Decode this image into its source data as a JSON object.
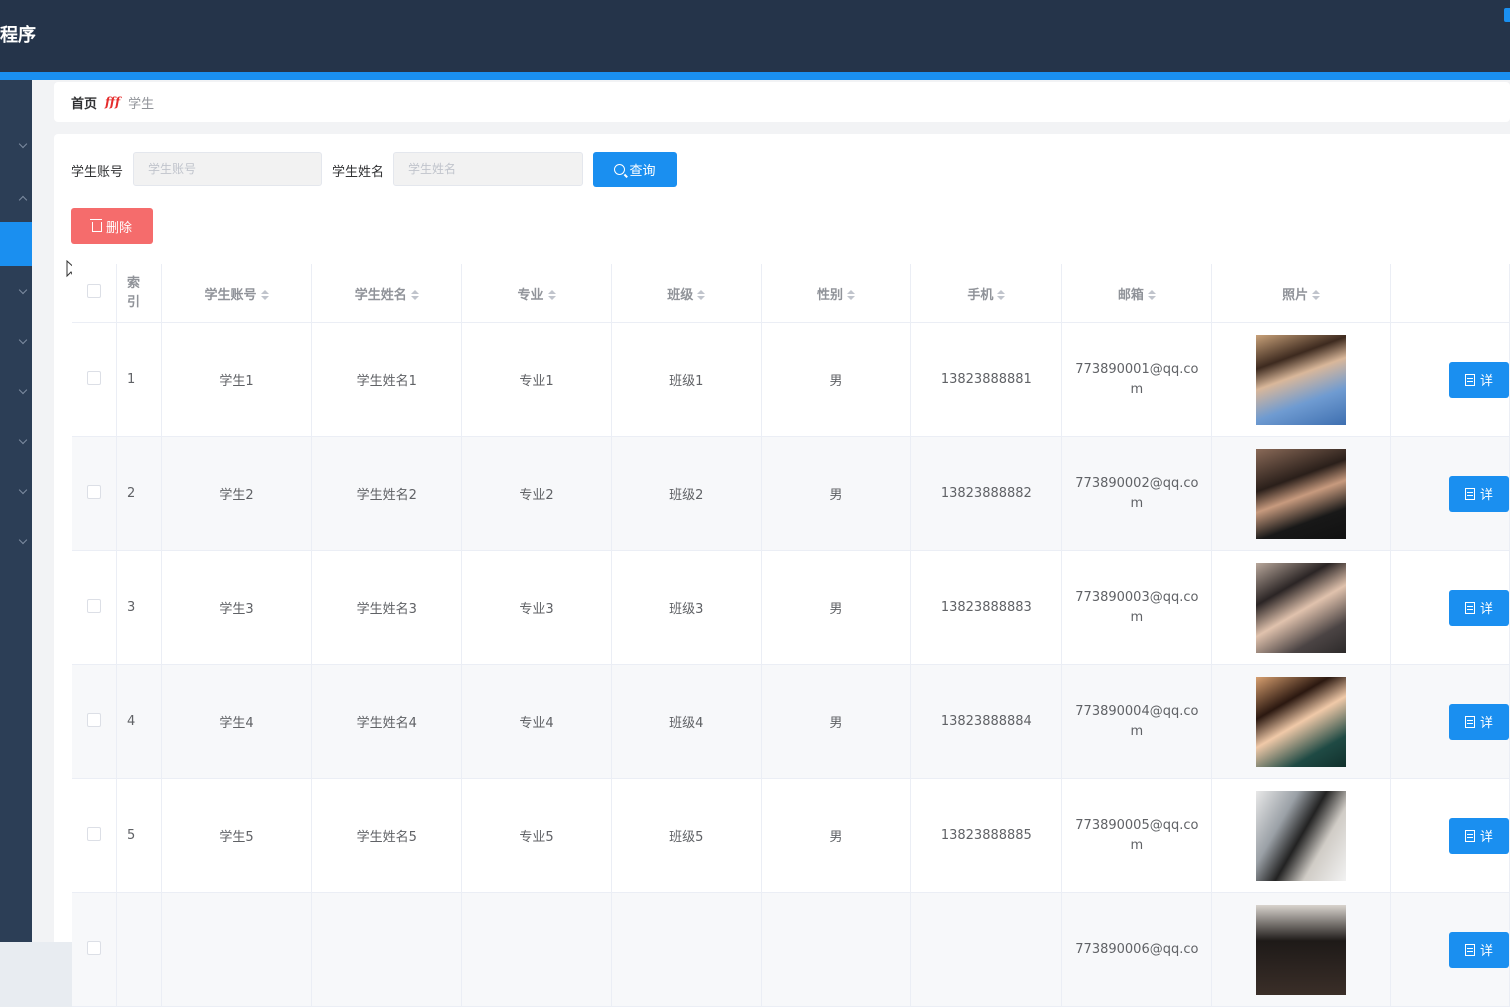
{
  "header": {
    "app_title": "程序"
  },
  "breadcrumb": {
    "home": "首页",
    "separator": "fff",
    "current": "学生"
  },
  "search": {
    "account_label": "学生账号",
    "account_placeholder": "学生账号",
    "name_label": "学生姓名",
    "name_placeholder": "学生姓名",
    "query_label": "查询"
  },
  "toolbar": {
    "delete_label": "删除"
  },
  "table": {
    "columns": [
      "索引",
      "学生账号",
      "学生姓名",
      "专业",
      "班级",
      "性别",
      "手机",
      "邮箱",
      "照片"
    ],
    "detail_label": "详",
    "rows": [
      {
        "index": "1",
        "account": "学生1",
        "name": "学生姓名1",
        "major": "专业1",
        "class": "班级1",
        "gender": "男",
        "phone": "13823888881",
        "email": "773890001@qq.com",
        "photo": "portrait-young-man-glasses-denim"
      },
      {
        "index": "2",
        "account": "学生2",
        "name": "学生姓名2",
        "major": "专业2",
        "class": "班级2",
        "gender": "男",
        "phone": "13823888882",
        "email": "773890002@qq.com",
        "photo": "portrait-young-man-dark"
      },
      {
        "index": "3",
        "account": "学生3",
        "name": "学生姓名3",
        "major": "专业3",
        "class": "班级3",
        "gender": "男",
        "phone": "13823888883",
        "email": "773890003@qq.com",
        "photo": "portrait-young-man-leaning"
      },
      {
        "index": "4",
        "account": "学生4",
        "name": "学生姓名4",
        "major": "专业4",
        "class": "班级4",
        "gender": "男",
        "phone": "13823888884",
        "email": "773890004@qq.com",
        "photo": "portrait-young-woman-profile"
      },
      {
        "index": "5",
        "account": "学生5",
        "name": "学生姓名5",
        "major": "专业5",
        "class": "班级5",
        "gender": "男",
        "phone": "13823888885",
        "email": "773890005@qq.com",
        "photo": "portrait-young-woman-standing"
      },
      {
        "index": "",
        "account": "",
        "name": "",
        "major": "",
        "class": "",
        "gender": "",
        "phone": "",
        "email": "773890006@qq.co",
        "photo": "portrait-young-man-partial"
      }
    ]
  },
  "colors": {
    "header_bg": "#25344a",
    "accent": "#1a8ff0",
    "sidebar_bg": "#2c3e56",
    "danger": "#f56c6c"
  }
}
